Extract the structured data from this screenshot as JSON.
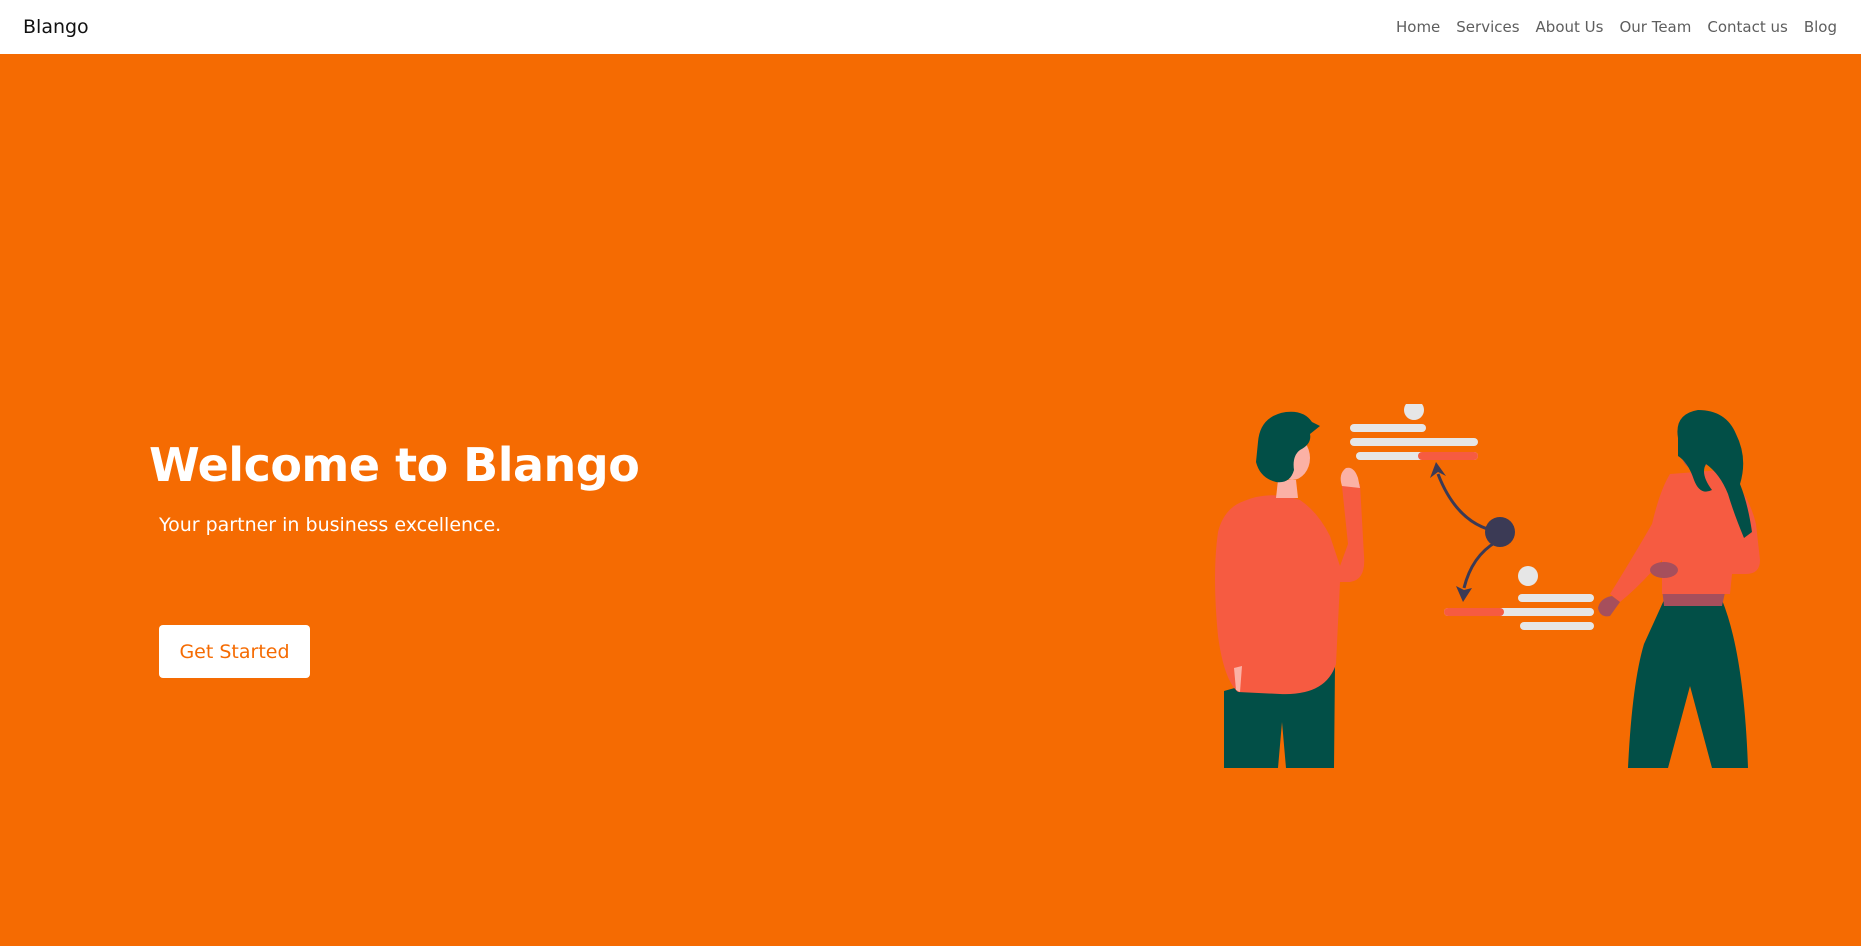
{
  "navbar": {
    "brand": "Blango",
    "links": [
      "Home",
      "Services",
      "About Us",
      "Our Team",
      "Contact us",
      "Blog"
    ]
  },
  "hero": {
    "title": "Welcome to Blango",
    "subtitle": "Your partner in business excellence.",
    "cta_label": "Get Started"
  },
  "colors": {
    "hero_background": "#f56b02",
    "navbar_background": "#ffffff",
    "illustration_shirt": "#f65b41",
    "illustration_pants": "#024f47",
    "illustration_hair": "#024f47",
    "illustration_skin": "#fbb1a5",
    "illustration_node": "#3b3a55",
    "illustration_bars": "#e6e6e6"
  },
  "illustration": {
    "name": "two-people-exchanging-data-illustration"
  }
}
